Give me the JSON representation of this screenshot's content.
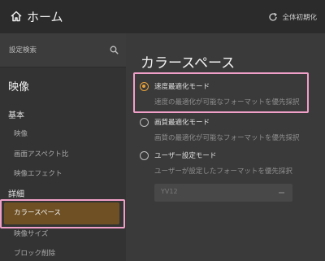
{
  "header": {
    "home_label": "ホーム",
    "reset_label": "全体初期化"
  },
  "sidebar": {
    "search_placeholder": "設定検索",
    "title": "映像",
    "sections": [
      {
        "label": "基本",
        "items": [
          "映像",
          "画面アスペクト比",
          "映像エフェクト"
        ]
      },
      {
        "label": "詳細",
        "items": [
          "カラースペース",
          "映像サイズ",
          "ブロック削除"
        ]
      }
    ],
    "selected_item": "カラースペース"
  },
  "main": {
    "title": "カラースペース",
    "options": [
      {
        "label": "速度最適化モード",
        "description": "速度の最適化が可能なフォーマットを優先採択",
        "checked": true
      },
      {
        "label": "画質最適化モード",
        "description": "画質の最適化が可能なフォーマットを優先採択",
        "checked": false
      },
      {
        "label": "ユーザー設定モード",
        "description": "ユーザーが設定したフォーマットを優先採択",
        "checked": false
      }
    ],
    "format_select": {
      "value": "YV12",
      "enabled": false
    }
  },
  "colors": {
    "accent": "#e9a23b",
    "selected_background": "#6e5024",
    "highlight_outline": "#f0a0c8"
  }
}
